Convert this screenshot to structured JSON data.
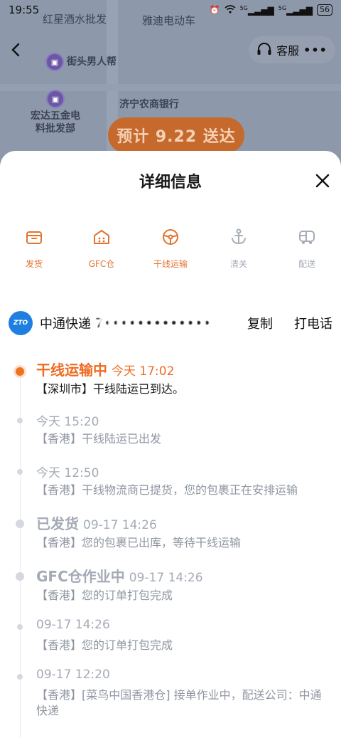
{
  "status_bar": {
    "time": "19:55",
    "battery": "56",
    "signal1": "5G",
    "signal2": "5G"
  },
  "map": {
    "pois": [
      {
        "label": "红星酒水批发"
      },
      {
        "label": "雅迪电动车"
      },
      {
        "label": "街头男人帮"
      },
      {
        "label": "宏达五金电\n料批发部"
      },
      {
        "label": "济宁农商银行"
      }
    ],
    "eta": "预计 9.22 送达"
  },
  "nav": {
    "service_label": "客服",
    "more": "•••"
  },
  "sheet": {
    "title": "详细信息",
    "stages": [
      {
        "label": "发货",
        "state": "done",
        "icon": "box-icon"
      },
      {
        "label": "GFC仓",
        "state": "done",
        "icon": "warehouse-icon"
      },
      {
        "label": "干线运输",
        "state": "done",
        "icon": "steering-wheel-icon"
      },
      {
        "label": "清关",
        "state": "pending",
        "icon": "anchor-icon"
      },
      {
        "label": "配送",
        "state": "pending",
        "icon": "truck-icon"
      }
    ],
    "carrier": {
      "name": "中通快递",
      "logo_text": "ZTO",
      "tracking_masked": "7•••••••••••••",
      "copy_label": "复制",
      "call_label": "打电话"
    },
    "events": [
      {
        "status": "干线运输中",
        "time": "今天 17:02",
        "desc": "【深圳市】干线陆运已到达。",
        "current": true
      },
      {
        "status": "",
        "time": "今天 15:20",
        "desc": "【香港】干线陆运已出发"
      },
      {
        "status": "",
        "time": "今天 12:50",
        "desc": "【香港】干线物流商已提货，您的包裹正在安排运输"
      },
      {
        "status": "已发货",
        "time": "09-17 14:26",
        "desc": "【香港】您的包裹已出库，等待干线运输"
      },
      {
        "status": "GFC仓作业中",
        "time": "09-17 14:26",
        "desc": "【香港】您的订单打包完成"
      },
      {
        "status": "",
        "time": "09-17 14:26",
        "desc": "【香港】您的订单打包完成"
      },
      {
        "status": "",
        "time": "09-17 12:20",
        "desc": "【香港】[菜鸟中国香港仓] 接单作业中，配送公司：中通快递"
      }
    ]
  },
  "colors": {
    "accent": "#ef6c21",
    "pending": "#a4abb6"
  }
}
